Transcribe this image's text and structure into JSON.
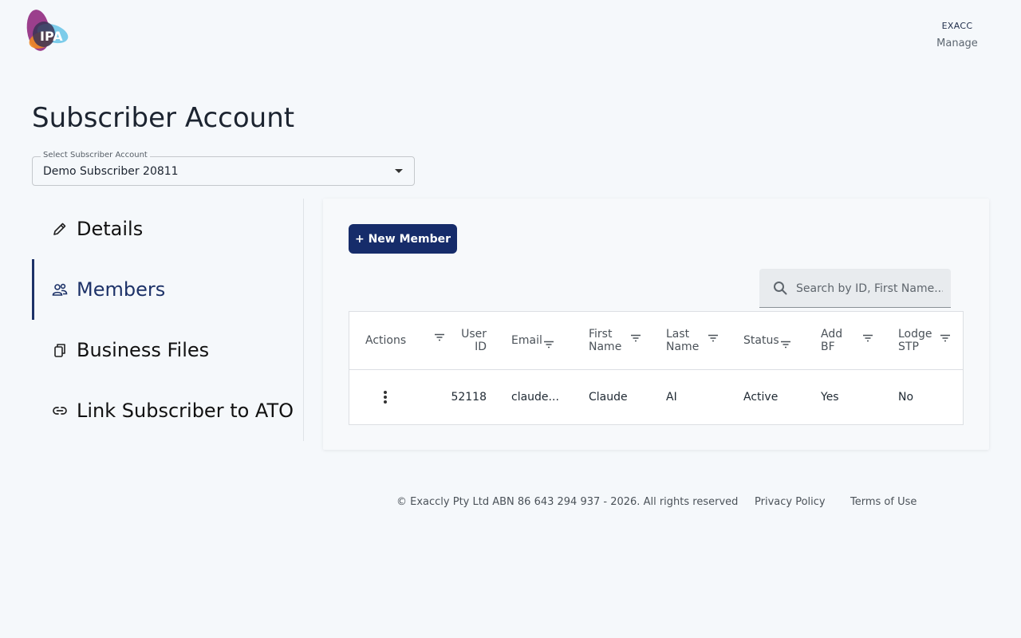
{
  "header": {
    "logo_text": "IPA",
    "org_code": "EXACC",
    "manage_label": "Manage"
  },
  "page": {
    "title": "Subscriber Account"
  },
  "subscriber_select": {
    "label": "Select Subscriber Account",
    "value": "Demo Subscriber 20811"
  },
  "sidebar": {
    "items": [
      {
        "label": "Details",
        "icon": "pencil-icon"
      },
      {
        "label": "Members",
        "icon": "people-icon",
        "active": true
      },
      {
        "label": "Business Files",
        "icon": "files-icon"
      },
      {
        "label": "Link Subscriber to ATO",
        "icon": "link-icon"
      }
    ]
  },
  "members": {
    "new_button": "+ New Member",
    "search_placeholder": "Search by ID, First Name...",
    "columns": [
      "Actions",
      "User\nID",
      "Email",
      "First\nName",
      "Last\nName",
      "Status",
      "Add\nBF",
      "Lodge\nSTP"
    ],
    "rows": [
      {
        "user_id": "52118",
        "email": "claude...",
        "first_name": "Claude",
        "last_name": "AI",
        "status": "Active",
        "add_bf": "Yes",
        "lodge_stp": "No"
      }
    ]
  },
  "footer": {
    "copyright": "© Exaccly Pty Ltd ABN 86 643 294 937 - 2026. All rights reserved",
    "privacy": "Privacy Policy",
    "terms": "Terms of Use"
  },
  "colors": {
    "primary": "#162c6a",
    "background": "#f5f8fb"
  }
}
